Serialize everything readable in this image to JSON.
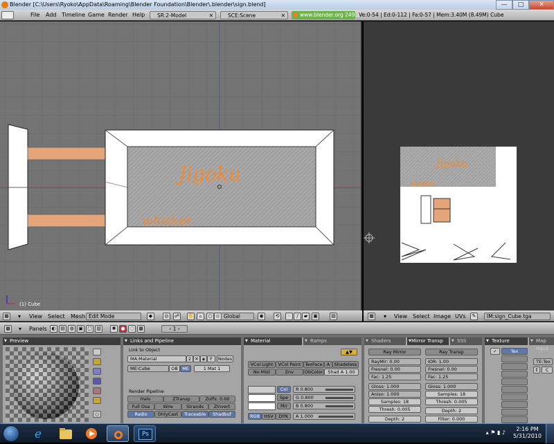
{
  "titlebar": {
    "title": "Blender [C:\\Users\\Ryoko\\AppData\\Roaming\\Blender Foundation\\Blender\\.blender\\sign.blend]",
    "minimize": "—",
    "maximize": "□",
    "close": "✕"
  },
  "topbar": {
    "menus": [
      "File",
      "Add",
      "Timeline",
      "Game",
      "Render",
      "Help"
    ],
    "screen_field": "SR:2-Model",
    "scene_field": "SCE:Scene",
    "link": "www.blender.org 249.2",
    "stats": "Ve:0-54 | Ed:0-112 | Fa:0-57 | Mem:3.40M (8.49M) Cube"
  },
  "viewport3d": {
    "object_label": "(1) Cube",
    "texture_text_main": "Jigoku",
    "texture_text_sub": "whisker"
  },
  "header3d": {
    "menus": [
      "View",
      "Select",
      "Mesh"
    ],
    "mode": "Edit Mode",
    "orientation": "Global"
  },
  "image_viewport": {
    "texture_text_main": "Jigoku",
    "texture_text_sub": "whisker"
  },
  "header_image": {
    "menus": [
      "View",
      "Select",
      "Image",
      "UVs"
    ],
    "image_field": "IM:sign_Cube.tga"
  },
  "buttons_header": {
    "panels_label": "Panels",
    "frame": "1"
  },
  "preview_panel": {
    "tab": "Preview"
  },
  "links_panel": {
    "tab": "Links and Pipeline",
    "link_to_object": "Link to Object",
    "material_field": "MA:Material",
    "users": "2",
    "f_button": "F",
    "nodes_button": "Nodes",
    "me_field": "ME:Cube",
    "ob_button": "OB",
    "me_button": "ME",
    "mat_counter": "1 Mat 1",
    "render_pipeline": "Render Pipeline",
    "halo": "Halo",
    "ztransp": "ZTransp",
    "zoffs": "Zoffs: 0.00",
    "full_osa": "Full Osa",
    "wire": "Wire",
    "strands": "Strands",
    "zinvert": "ZInvert",
    "radio": "Radio",
    "only_cast": "OnlyCast",
    "traceable": "Traceable",
    "shadbuf": "Shadbuf"
  },
  "material_panel": {
    "tab": "Material",
    "tab2": "Ramps",
    "vcol_light": "VCol Light",
    "vcol_paint": "VCol Paint",
    "texface": "TexFace",
    "a": "A",
    "shadeless": "Shadeless",
    "no_mist": "No Mist",
    "env": "Env",
    "obcolor": "ObColor",
    "shad_a": "Shad A 1.00",
    "col": "Col",
    "spe": "Spe",
    "mir": "Mir",
    "r": "R 0.800",
    "g": "G 0.800",
    "bv": "B 0.800",
    "rgb": "RGB",
    "hsv": "HSV",
    "dyn": "DYN",
    "alpha": "A 1.000"
  },
  "shaders_panel": {
    "tab": "Shaders",
    "tab2": "Mirror Transp",
    "tab3": "SSS",
    "ray_mirror": "Ray Mirror",
    "ray_transp": "Ray Transp",
    "raymir": "RayMir: 0.00",
    "ior": "IOR: 1.00",
    "fresnel_l": "Fresnel: 0.00",
    "fresnel_r": "Fresnel: 0.00",
    "fac_l": "Fac: 1.25",
    "fac_r": "Fac: 1.25",
    "gloss_l": "Gloss: 1.000",
    "gloss_r": "Gloss: 1.000",
    "aniso": "Aniso: 1.000",
    "samples_l": "Samples: 18",
    "samples_r": "Samples: 18",
    "thresh_l": "Thresh: 0.005",
    "thresh_r": "Thresh: 0.005",
    "depth_l": "Depth: 2",
    "depth_r": "Depth: 2",
    "filter": "Filter: 0.000"
  },
  "texture_panel": {
    "tab": "Texture",
    "tab2": "Map Input",
    "tex_slot": "Tex",
    "te_field": "TE:Tex",
    "c_button": "C"
  },
  "taskbar": {
    "time": "2:16 PM",
    "date": "5/31/2010",
    "ps_label": "Ps"
  },
  "colors": {
    "viewport_bg": "#747474",
    "wood": "#e3a579",
    "texture_text": "#f08a34",
    "link_green": "#6cb44a"
  }
}
